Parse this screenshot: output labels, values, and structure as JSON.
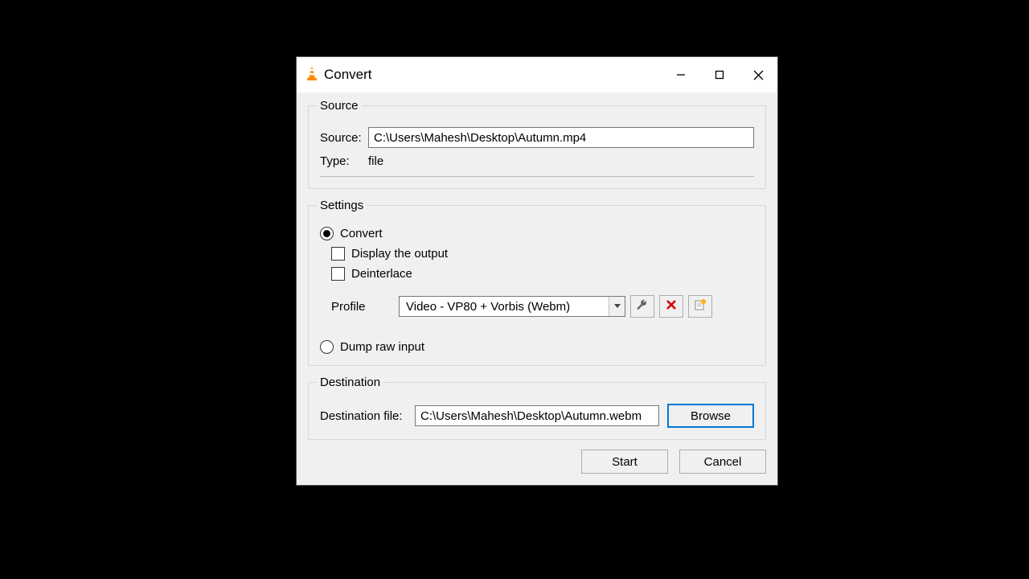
{
  "window": {
    "title": "Convert"
  },
  "source": {
    "legend": "Source",
    "source_label": "Source:",
    "source_value": "C:\\Users\\Mahesh\\Desktop\\Autumn.mp4",
    "type_label": "Type:",
    "type_value": "file"
  },
  "settings": {
    "legend": "Settings",
    "convert_label": "Convert",
    "display_output_label": "Display the output",
    "deinterlace_label": "Deinterlace",
    "profile_label": "Profile",
    "profile_value": "Video - VP80 + Vorbis (Webm)",
    "dump_raw_label": "Dump raw input"
  },
  "destination": {
    "legend": "Destination",
    "dest_label": "Destination file:",
    "dest_value": "C:\\Users\\Mahesh\\Desktop\\Autumn.webm",
    "browse_label": "Browse"
  },
  "buttons": {
    "start": "Start",
    "cancel": "Cancel"
  }
}
